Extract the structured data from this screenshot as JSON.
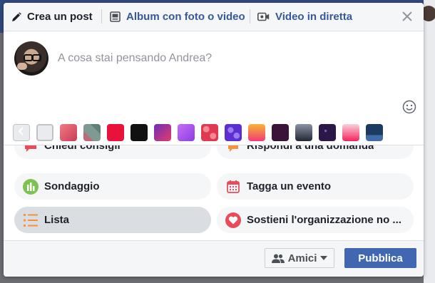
{
  "tabs": [
    {
      "label": "Crea un post",
      "icon": "pencil-icon"
    },
    {
      "label": "Album con foto o video",
      "icon": "photo-album-icon"
    },
    {
      "label": "Video in diretta",
      "icon": "video-camera-icon"
    }
  ],
  "composer": {
    "placeholder": "A cosa stai pensando Andrea?"
  },
  "backgrounds": {
    "colors": [
      "#e9ebee",
      "#e05466",
      "#8a9a95",
      "#e8123c",
      "#111111",
      "#c62a88",
      "#a855f7",
      "#e84b5a",
      "#6d3fd6",
      "#f97b3a",
      "#3b1238",
      "#3c4352",
      "#2b1848",
      "#f53b6c",
      "#1c3b63"
    ]
  },
  "options": [
    {
      "label": "Chiedi consigli",
      "icon": "chat-bubble-icon",
      "color": "#e84b5a"
    },
    {
      "label": "Rispondi a una domanda",
      "icon": "answer-icon",
      "color": "#f7923a"
    },
    {
      "label": "Sondaggio",
      "icon": "poll-icon",
      "color": "#7cc352"
    },
    {
      "label": "Tagga un evento",
      "icon": "calendar-icon",
      "color": "#e84b5a"
    },
    {
      "label": "Lista",
      "icon": "list-icon",
      "color": "#f7923a"
    },
    {
      "label": "Sostieni l'organizzazione no ...",
      "icon": "heart-donate-icon",
      "color": "#e84b5a"
    }
  ],
  "footer": {
    "audience_label": "Amici",
    "publish_label": "Pubblica"
  },
  "colors": {
    "accent": "#4267b2",
    "link": "#365899"
  }
}
